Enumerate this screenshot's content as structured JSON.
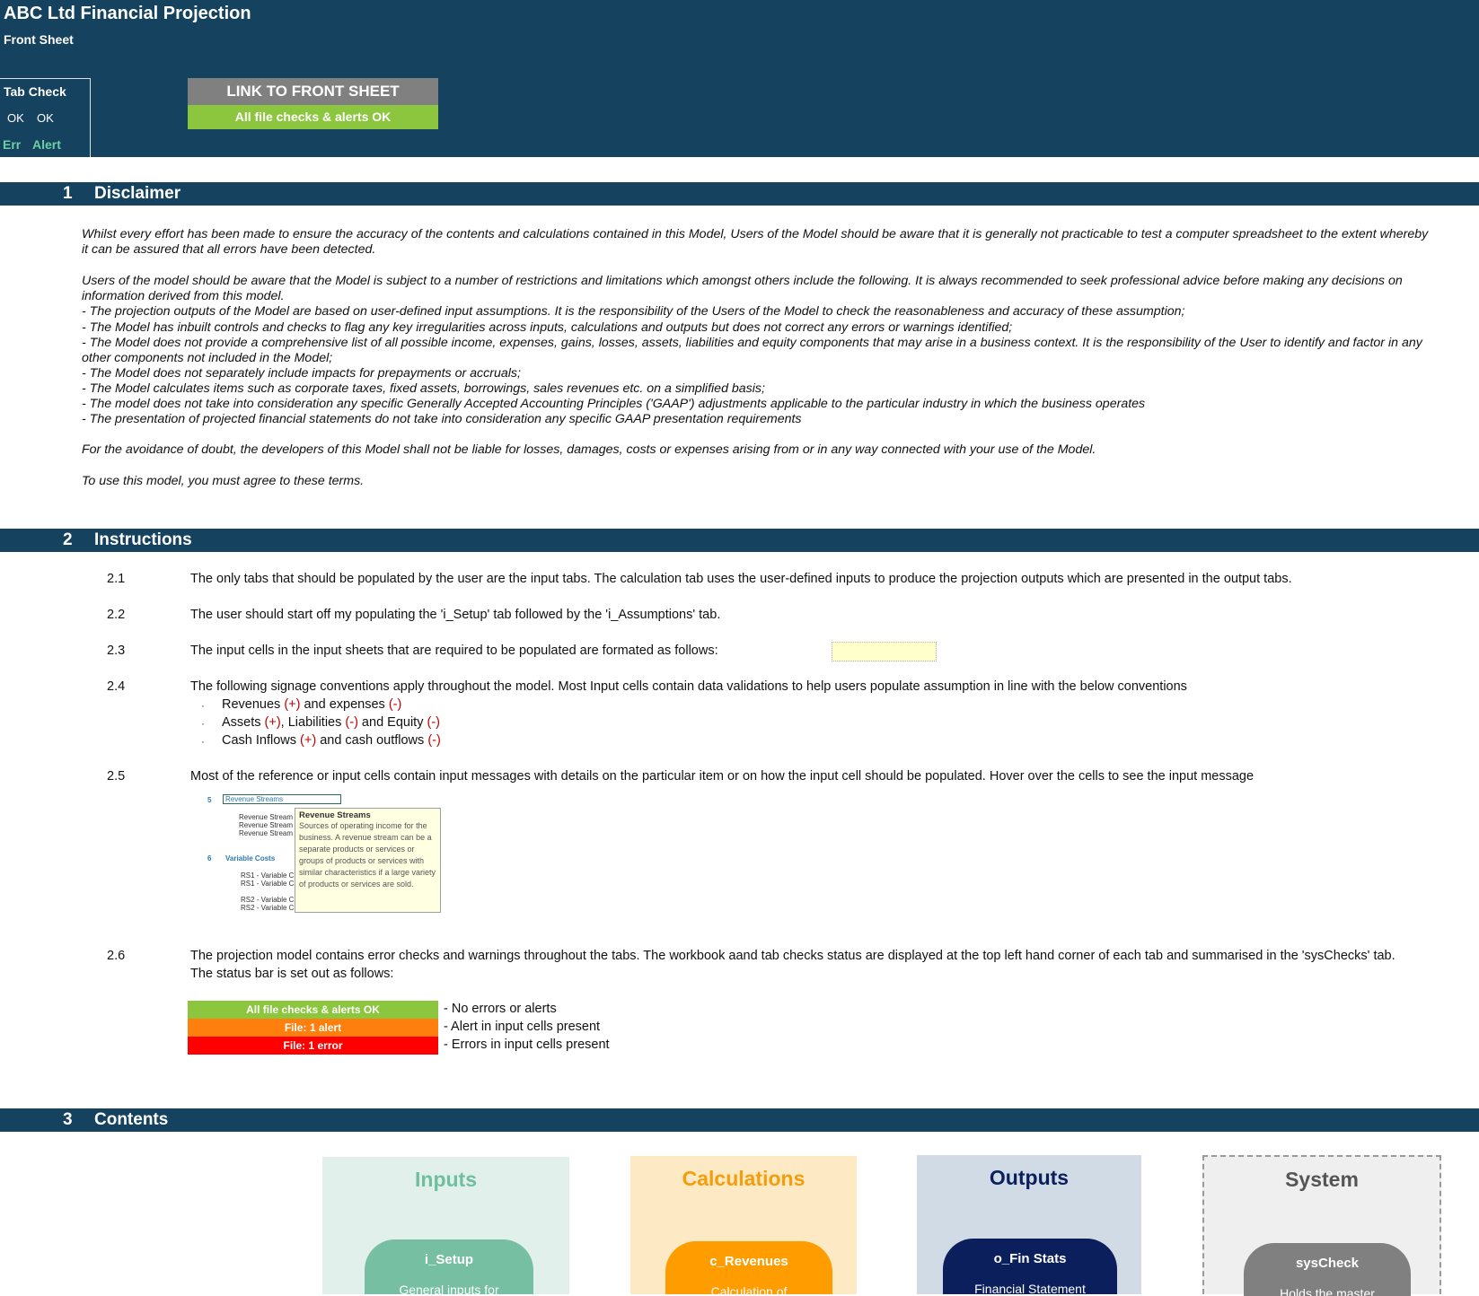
{
  "header": {
    "title": "ABC Ltd Financial Projection",
    "subtitle": "Front Sheet",
    "tab_check": {
      "label": "Tab Check",
      "ok1": "OK",
      "ok2": "OK",
      "err": "Err",
      "alert": "Alert"
    },
    "link_button": "LINK TO FRONT SHEET",
    "status": "All file checks & alerts OK"
  },
  "sections": {
    "disclaimer": {
      "number": "1",
      "title": "Disclaimer"
    },
    "instructions": {
      "number": "2",
      "title": "Instructions"
    },
    "contents": {
      "number": "3",
      "title": "Contents"
    }
  },
  "disclaimer": {
    "p1": "Whilst every effort has been made to ensure the accuracy of the contents and calculations contained in this Model, Users of the Model should be aware that it is generally not practicable to test a computer spreadsheet to the extent whereby it can be assured that all errors have been detected.",
    "p2": "Users of the model should be aware that the Model is subject to a number of restrictions and limitations which amongst others include the following. It is always recommended to seek professional advice before making any decisions on information derived from this model.",
    "b1": "- The projection outputs of the Model are based on user-defined input assumptions. It is the responsibility of the Users of the Model to check the reasonableness and accuracy of these assumption;",
    "b2": "- The Model has inbuilt controls and checks to flag any key irregularities across inputs, calculations and outputs but does not correct any errors or warnings identified;",
    "b3": "- The Model does not provide a comprehensive list of all possible income, expenses, gains, losses, assets, liabilities and equity components that may arise in a business context. It is the responsibility of the User to identify and factor in any other components not included in the Model;",
    "b4": "- The Model does not separately include impacts for prepayments or accruals;",
    "b5": "- The Model calculates items such as corporate taxes, fixed assets, borrowings, sales revenues etc. on a simplified basis;",
    "b6": "- The model does not take into consideration any specific Generally Accepted Accounting Principles ('GAAP') adjustments applicable to the particular industry in which the business operates",
    "b7": "- The presentation of projected financial statements do not take into consideration any specific GAAP presentation requirements",
    "p3": "For the avoidance of doubt, the developers of this Model shall not be liable for losses, damages, costs or expenses arising from or in any way connected with your use of the Model.",
    "p4": "To use this model, you must agree to these terms."
  },
  "instructions": {
    "i1": {
      "num": "2.1",
      "text": "The only tabs that should be populated by the user are the input tabs. The calculation tab uses the user-defined inputs to produce the projection outputs which are presented in the output tabs."
    },
    "i2": {
      "num": "2.2",
      "text": "The user should start off my populating the 'i_Setup' tab followed by the 'i_Assumptions' tab."
    },
    "i3": {
      "num": "2.3",
      "text": "The input cells in the input sheets that are required to be populated are formated as follows:"
    },
    "i4": {
      "num": "2.4",
      "text": "The following signage conventions apply throughout the model. Most Input cells contain data validations to help users populate assumption in line with the below conventions"
    },
    "bullets": {
      "b1": {
        "dot": "·",
        "a": "Revenues ",
        "b": "(+)",
        "c": " and expenses ",
        "d": "(-)"
      },
      "b2": {
        "dot": "·",
        "a": "Assets ",
        "b": "(+)",
        "c": ", Liabilities ",
        "d": "(-)",
        "e": " and Equity ",
        "f": "(-)"
      },
      "b3": {
        "dot": "·",
        "a": "Cash Inflows ",
        "b": "(+)",
        "c": " and cash outflows ",
        "d": "(-)"
      }
    },
    "i5": {
      "num": "2.5",
      "text": "Most of the reference or input cells contain input messages with details on the particular item or on how the input cell should be populated. Hover over the cells to see the input message"
    },
    "thumb": {
      "n5": "5",
      "cell": "Revenue Streams",
      "r1": "Revenue Stream",
      "r2": "Revenue Stream",
      "r3": "Revenue Stream",
      "n6": "6",
      "vc": "Variable Costs",
      "v1": "RS1 - Variable C",
      "v2": "RS1 - Variable C",
      "v3": "RS2 - Variable C",
      "v4": "RS2 - Variable C",
      "tip_title": "Revenue Streams",
      "tip_body": "Sources of operating income for the business. A revenue stream can be a separate products or services or groups of products or services with similar characteristics if a large variety of products or services are sold."
    },
    "i6": {
      "num": "2.6",
      "text": "The projection model contains error checks and warnings throughout the tabs. The workbook aand tab checks status are displayed at the top left hand corner of each tab and summarised in the 'sysChecks' tab.",
      "text2": "The status bar is set out as follows:"
    },
    "status_rows": [
      {
        "label": "All file checks & alerts OK",
        "desc": "- No errors or alerts",
        "color": "#8cc63f"
      },
      {
        "label": "File: 1 alert",
        "desc": "- Alert in input cells present",
        "color": "#ff7f0e"
      },
      {
        "label": "File: 1 error",
        "desc": "- Errors in input cells present",
        "color": "#ff0000"
      }
    ]
  },
  "contents": {
    "inputs": {
      "title": "Inputs",
      "pill": "i_Setup",
      "desc": "General inputs for",
      "bg": "#e2f0eb",
      "title_color": "#6fbf9f",
      "pill_color": "#76bfa3"
    },
    "calculations": {
      "title": "Calculations",
      "pill": "c_Revenues",
      "desc": "Calculation of",
      "bg": "#fde9c4",
      "title_color": "#f59d0a",
      "pill_color": "#ff9c00"
    },
    "outputs": {
      "title": "Outputs",
      "pill": "o_Fin Stats",
      "desc": "Financial Statement",
      "bg": "#d0dbe6",
      "title_color": "#0b1f5c",
      "pill_color": "#0b1f5c"
    },
    "system": {
      "title": "System",
      "pill": "sysCheck",
      "desc": "Holds the master",
      "bg": "#efefef",
      "title_color": "#555555",
      "pill_color": "#808080"
    }
  }
}
